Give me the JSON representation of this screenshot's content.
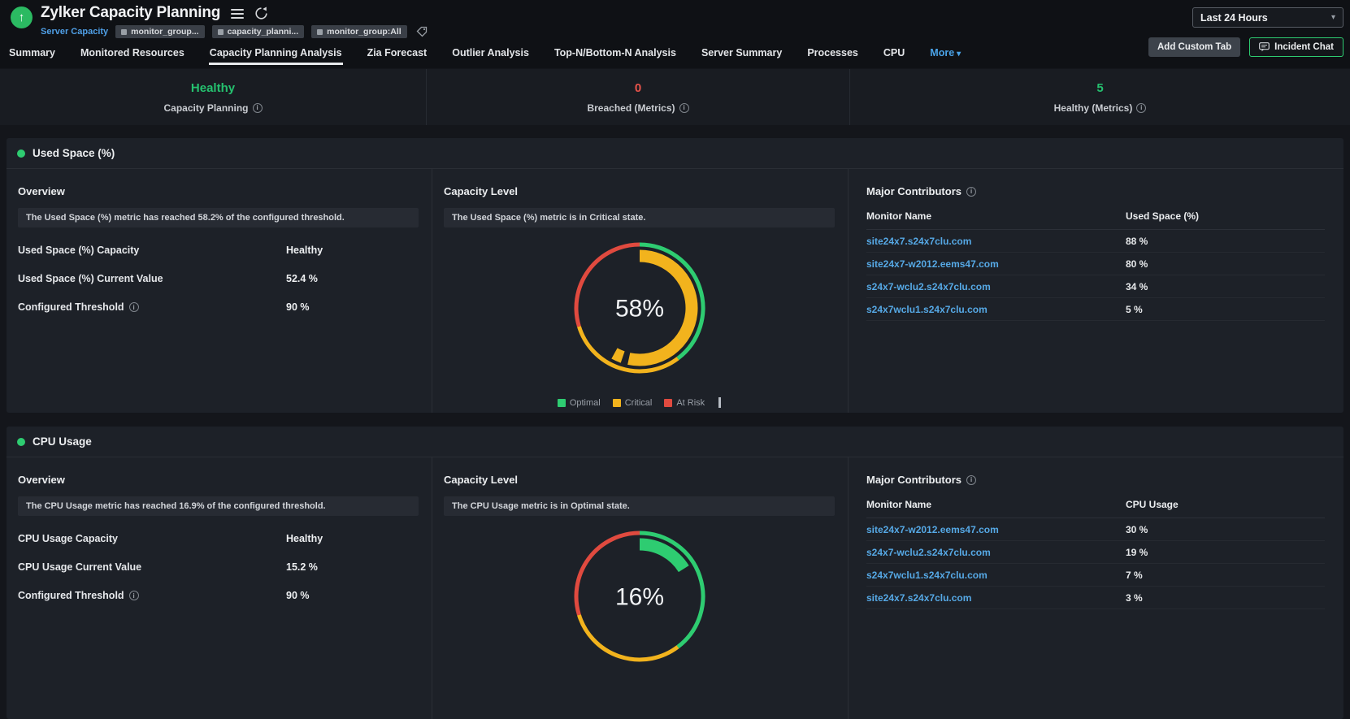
{
  "header": {
    "title": "Zylker Capacity Planning",
    "monitor_type_link": "Server Capacity",
    "tags": [
      {
        "label": "monitor_group..."
      },
      {
        "label": "capacity_planni..."
      },
      {
        "label": "monitor_group:All"
      }
    ],
    "time_range": "Last 24 Hours",
    "buttons": {
      "add_custom_tab": "Add Custom Tab",
      "incident_chat": "Incident Chat"
    }
  },
  "tabs": [
    {
      "label": "Summary"
    },
    {
      "label": "Monitored Resources"
    },
    {
      "label": "Capacity Planning Analysis",
      "active": true
    },
    {
      "label": "Zia Forecast"
    },
    {
      "label": "Outlier Analysis"
    },
    {
      "label": "Top-N/Bottom-N Analysis"
    },
    {
      "label": "Server Summary"
    },
    {
      "label": "Processes"
    },
    {
      "label": "CPU"
    },
    {
      "label": "More"
    }
  ],
  "status_bar": {
    "items": [
      {
        "value": "Healthy",
        "label": "Capacity Planning",
        "state": "healthy"
      },
      {
        "value": "0",
        "label": "Breached (Metrics)",
        "state": "breached"
      },
      {
        "value": "5",
        "label": "Healthy (Metrics)",
        "state": "healthy"
      }
    ]
  },
  "sections": [
    {
      "title": "Used Space (%)",
      "overview": {
        "heading": "Overview",
        "message": "The Used Space (%) metric has reached 58.2% of the configured threshold.",
        "rows": [
          {
            "label": "Used Space (%) Capacity",
            "value": "Healthy"
          },
          {
            "label": "Used Space (%) Current Value",
            "value": "52.4 %"
          },
          {
            "label": "Configured Threshold",
            "value": "90 %"
          }
        ]
      },
      "capacity_level": {
        "heading": "Capacity Level",
        "message": "The Used Space (%) metric is in Critical state."
      },
      "contributors": {
        "heading": "Major Contributors",
        "columns": [
          "Monitor Name",
          "Used Space (%)"
        ],
        "rows": [
          {
            "monitor": "site24x7.s24x7clu.com",
            "value": "88 %"
          },
          {
            "monitor": "site24x7-w2012.eems47.com",
            "value": "80 %"
          },
          {
            "monitor": "s24x7-wclu2.s24x7clu.com",
            "value": "34 %"
          },
          {
            "monitor": "s24x7wclu1.s24x7clu.com",
            "value": "5 %"
          }
        ]
      }
    },
    {
      "title": "CPU Usage",
      "overview": {
        "heading": "Overview",
        "message": "The CPU Usage metric has reached 16.9% of the configured threshold.",
        "rows": [
          {
            "label": "CPU Usage Capacity",
            "value": "Healthy"
          },
          {
            "label": "CPU Usage Current Value",
            "value": "15.2 %"
          },
          {
            "label": "Configured Threshold",
            "value": "90 %"
          }
        ]
      },
      "capacity_level": {
        "heading": "Capacity Level",
        "message": "The CPU Usage metric is in Optimal state."
      },
      "contributors": {
        "heading": "Major Contributors",
        "columns": [
          "Monitor Name",
          "CPU Usage"
        ],
        "rows": [
          {
            "monitor": "site24x7-w2012.eems47.com",
            "value": "30 %"
          },
          {
            "monitor": "s24x7-wclu2.s24x7clu.com",
            "value": "19 %"
          },
          {
            "monitor": "s24x7wclu1.s24x7clu.com",
            "value": "7 %"
          },
          {
            "monitor": "site24x7.s24x7clu.com",
            "value": "3 %"
          }
        ]
      }
    }
  ],
  "chart_data": [
    {
      "type": "donut-gauge",
      "title": "Used Space (%) Capacity Level",
      "value_pct": 58,
      "center_label": "58%",
      "state": "Critical",
      "progress_color": "#f2b31d",
      "progress_arcs": [
        [
          0,
          192
        ],
        [
          199,
          209
        ]
      ],
      "ring_segments": [
        {
          "label": "Optimal",
          "color": "#2ecc71",
          "start": 0,
          "end": 143
        },
        {
          "label": "Critical",
          "color": "#f2b31d",
          "start": 143,
          "end": 253
        },
        {
          "label": "At Risk",
          "color": "#e04a3f",
          "start": 253,
          "end": 360
        }
      ],
      "legend": [
        {
          "label": "Optimal",
          "color": "#2ecc71"
        },
        {
          "label": "Critical",
          "color": "#f2b31d"
        },
        {
          "label": "At Risk",
          "color": "#e04a3f"
        }
      ]
    },
    {
      "type": "donut-gauge",
      "title": "CPU Usage Capacity Level",
      "value_pct": 16,
      "center_label": "16%",
      "state": "Optimal",
      "progress_color": "#2ecc71",
      "progress_arcs": [
        [
          0,
          58
        ]
      ],
      "ring_segments": [
        {
          "label": "Optimal",
          "color": "#2ecc71",
          "start": 0,
          "end": 143
        },
        {
          "label": "Critical",
          "color": "#f2b31d",
          "start": 143,
          "end": 253
        },
        {
          "label": "At Risk",
          "color": "#e04a3f",
          "start": 253,
          "end": 360
        }
      ]
    }
  ],
  "colors": {
    "healthy": "#25c16f",
    "breached": "#e8534a",
    "link": "#56a9e6",
    "accent_blue": "#4aa3e8"
  }
}
